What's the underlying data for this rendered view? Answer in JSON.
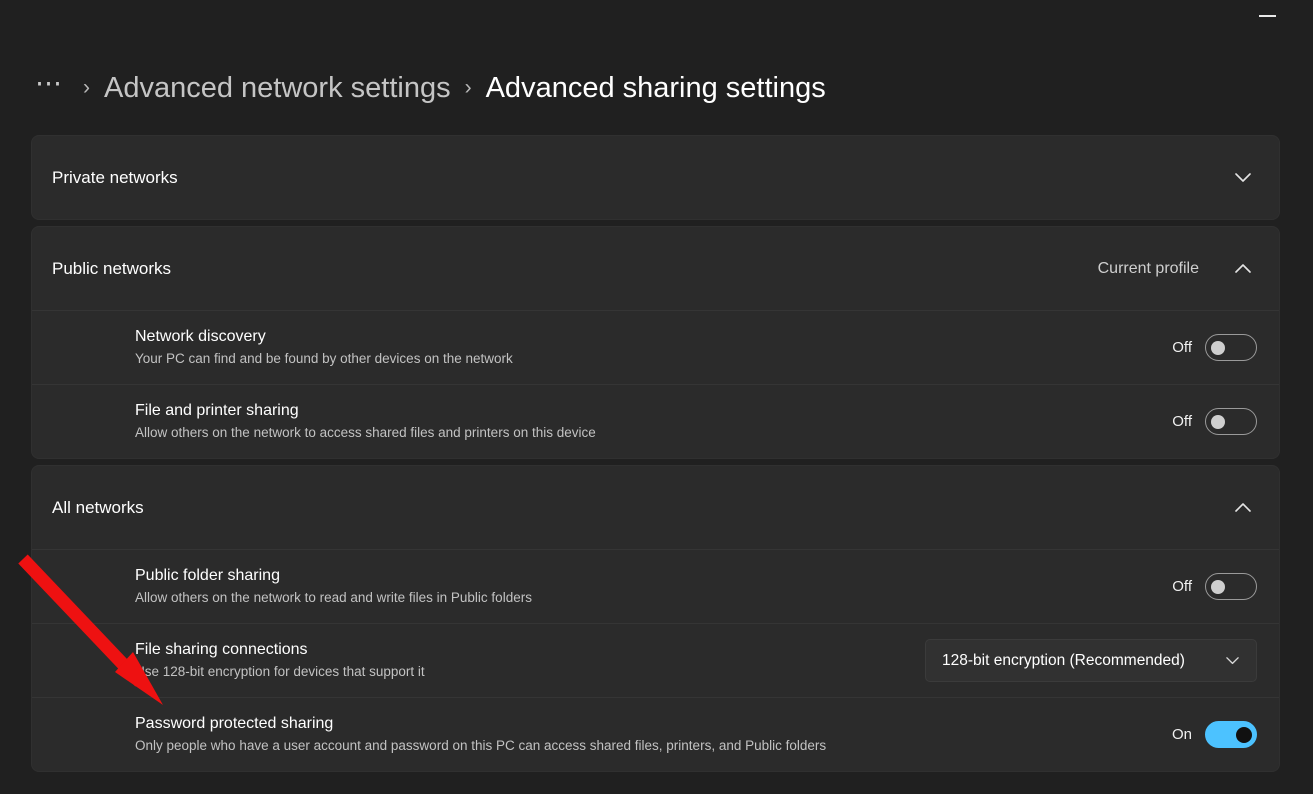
{
  "window": {
    "minimize_label": "Minimize"
  },
  "breadcrumb": {
    "ellipsis": "⋯",
    "separator": "›",
    "parent": "Advanced network settings",
    "current": "Advanced sharing settings"
  },
  "colors": {
    "page_background": "#202020",
    "card_background": "#2b2b2b",
    "accent_on": "#4cc2ff",
    "annotation_arrow": "#ee1111"
  },
  "sections": [
    {
      "title": "Private networks",
      "meta": "",
      "expanded": false,
      "chevron": "chevron-down-icon",
      "rows": []
    },
    {
      "title": "Public networks",
      "meta": "Current profile",
      "expanded": true,
      "chevron": "chevron-up-icon",
      "rows": [
        {
          "title": "Network discovery",
          "desc": "Your PC can find and be found by other devices on the network",
          "control": "toggle",
          "state_label": "Off",
          "state": "off"
        },
        {
          "title": "File and printer sharing",
          "desc": "Allow others on the network to access shared files and printers on this device",
          "control": "toggle",
          "state_label": "Off",
          "state": "off"
        }
      ]
    },
    {
      "title": "All networks",
      "meta": "",
      "expanded": true,
      "chevron": "chevron-up-icon",
      "rows": [
        {
          "title": "Public folder sharing",
          "desc": "Allow others on the network to read and write files in Public folders",
          "control": "toggle",
          "state_label": "Off",
          "state": "off"
        },
        {
          "title": "File sharing connections",
          "desc": "Use 128-bit encryption for devices that support it",
          "control": "dropdown",
          "state_label": "128-bit encryption (Recommended)",
          "state": "dropdown"
        },
        {
          "title": "Password protected sharing",
          "desc": "Only people who have a user account and password on this PC can access shared files, printers, and Public folders",
          "control": "toggle",
          "state_label": "On",
          "state": "on"
        }
      ]
    }
  ]
}
